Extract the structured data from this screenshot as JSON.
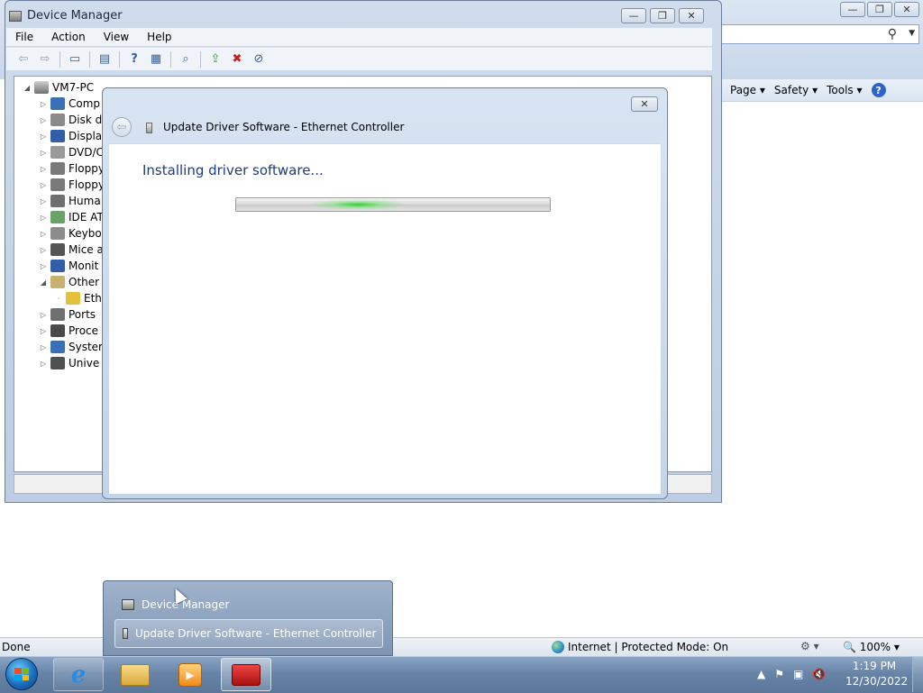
{
  "ie": {
    "cmdbar": {
      "page": "Page ▾",
      "safety": "Safety ▾",
      "tools": "Tools ▾"
    },
    "status": {
      "left": "Done",
      "zone": "Internet | Protected Mode: On",
      "zoom": "100%"
    }
  },
  "device_manager": {
    "title": "Device Manager",
    "menu": [
      "File",
      "Action",
      "View",
      "Help"
    ],
    "tree": {
      "root": "VM7-PC",
      "items": [
        {
          "label": "Comp",
          "icon": "computer-icon",
          "color": "#3b6fb6"
        },
        {
          "label": "Disk d",
          "icon": "disk-drive-icon",
          "color": "#8a8a8a"
        },
        {
          "label": "Displa",
          "icon": "display-adapter-icon",
          "color": "#2f5da8"
        },
        {
          "label": "DVD/C",
          "icon": "dvd-drive-icon",
          "color": "#9a9a9a"
        },
        {
          "label": "Floppy",
          "icon": "floppy-controller-icon",
          "color": "#7a7a7a"
        },
        {
          "label": "Floppy",
          "icon": "floppy-drive-icon",
          "color": "#7a7a7a"
        },
        {
          "label": "Huma",
          "icon": "hid-icon",
          "color": "#6f6f6f"
        },
        {
          "label": "IDE AT",
          "icon": "ide-controller-icon",
          "color": "#6aa36a"
        },
        {
          "label": "Keybo",
          "icon": "keyboard-icon",
          "color": "#8c8c8c"
        },
        {
          "label": "Mice a",
          "icon": "mouse-icon",
          "color": "#555555"
        },
        {
          "label": "Monit",
          "icon": "monitor-icon",
          "color": "#2f5da8"
        },
        {
          "label": "Other",
          "icon": "other-devices-icon",
          "color": "#c8b070",
          "expanded": true
        },
        {
          "label": "Eth",
          "icon": "warning-device-icon",
          "color": "#e3c13a",
          "child": true
        },
        {
          "label": "Ports",
          "icon": "ports-icon",
          "color": "#707070"
        },
        {
          "label": "Proce",
          "icon": "processor-icon",
          "color": "#4a4a4a"
        },
        {
          "label": "Syster",
          "icon": "system-devices-icon",
          "color": "#3b6fb6"
        },
        {
          "label": "Unive",
          "icon": "usb-icon",
          "color": "#505050"
        }
      ]
    }
  },
  "dialog": {
    "title": "Update Driver Software - Ethernet Controller",
    "heading": "Installing driver software...",
    "progress_state": "indeterminate"
  },
  "taskbar": {
    "popup_items": [
      "Device Manager",
      "Update Driver Software - Ethernet Controller"
    ],
    "clock_time": "1:19 PM",
    "clock_date": "12/30/2022"
  }
}
